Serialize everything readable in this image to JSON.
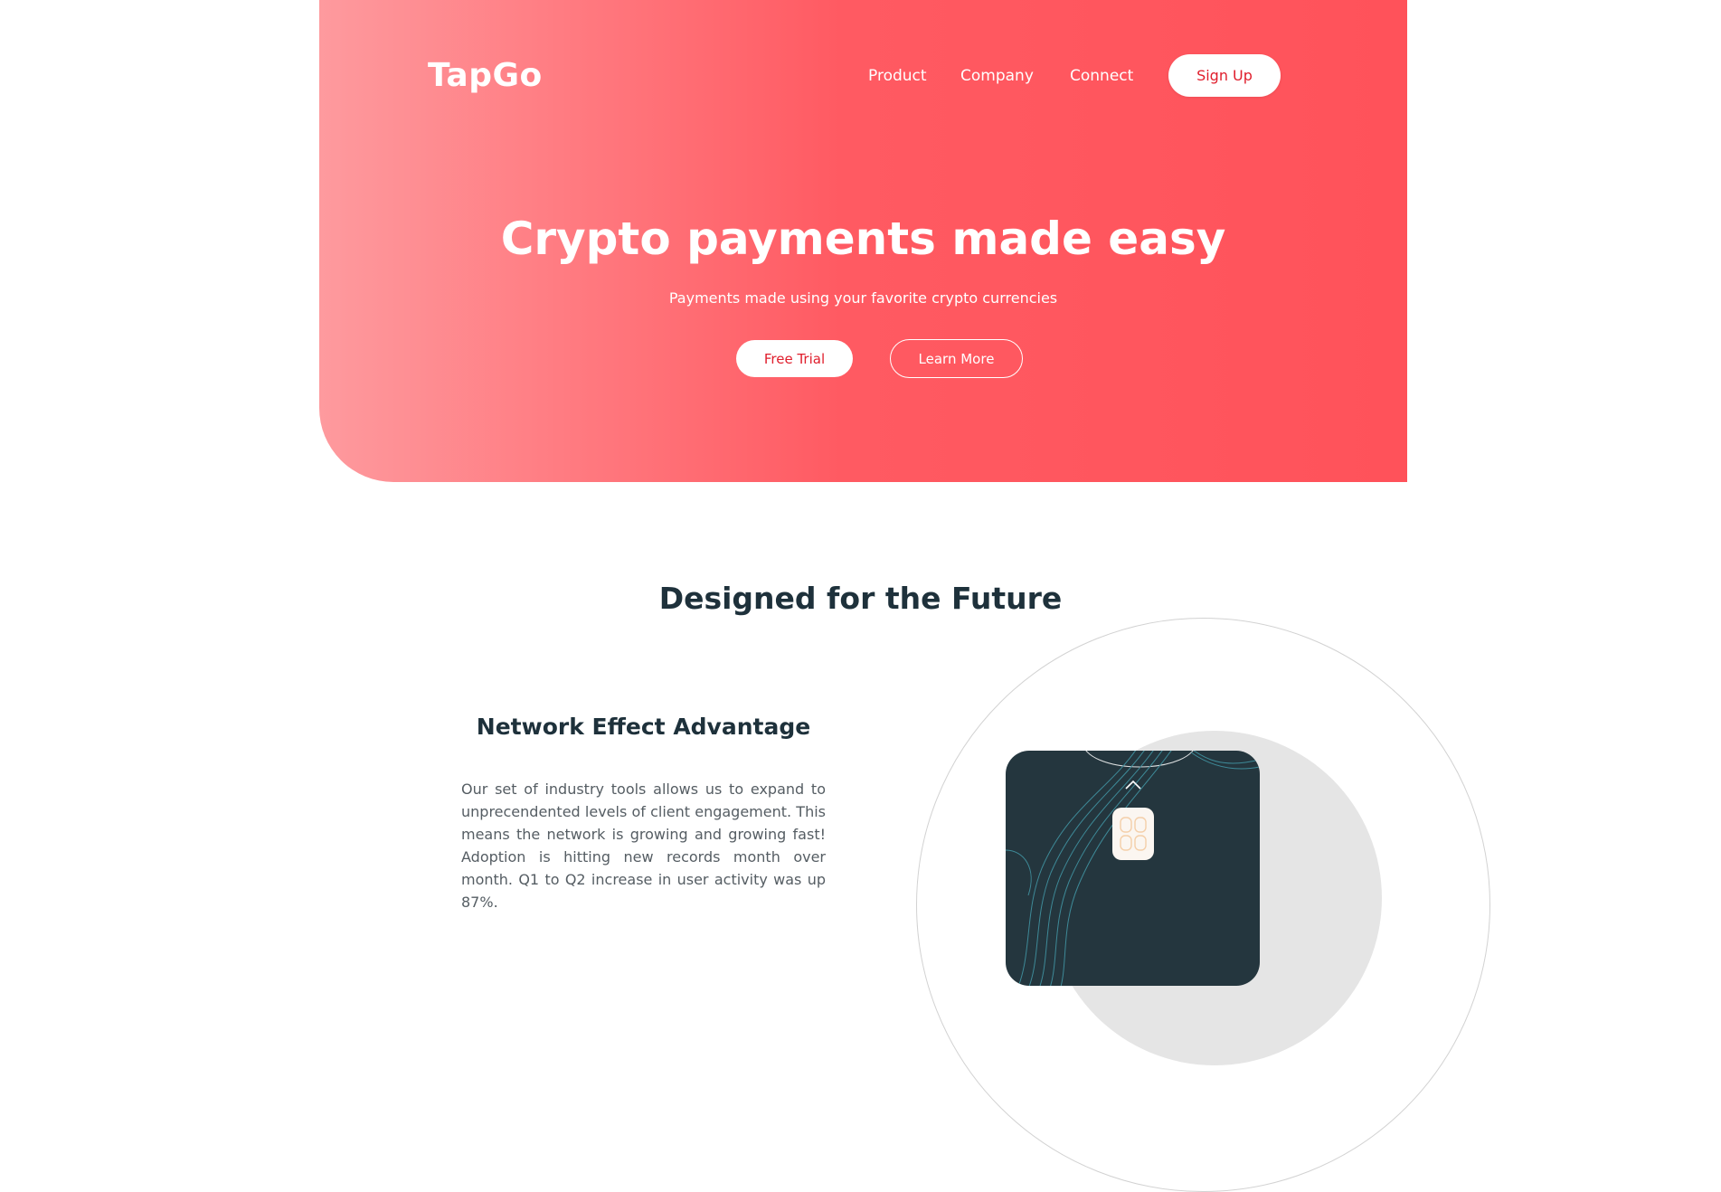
{
  "brand": {
    "logo_text": "TapGo",
    "accent_color": "#ff525a",
    "gradient_start": "#fe9a9e",
    "button_text_color": "#e01e2c",
    "dark_text_color": "#1e313b"
  },
  "nav": {
    "items": [
      {
        "label": "Product"
      },
      {
        "label": "Company"
      },
      {
        "label": "Connect"
      }
    ],
    "signup_label": "Sign Up"
  },
  "hero": {
    "title": "Crypto payments made easy",
    "subtitle": "Payments made using your favorite crypto currencies",
    "primary_button": "Free Trial",
    "secondary_button": "Learn More"
  },
  "features": {
    "section_title": "Designed for the Future",
    "heading": "Network Effect Advantage",
    "body": "Our set of industry tools allows us to expand to unprecendented levels of client engagement. This means the network is growing and growing fast! Adoption is hitting new records month over month. Q1 to Q2 increase in user activity was up 87%."
  },
  "illustration": {
    "card_color": "#24363e",
    "chip_color": "#fbf6f1",
    "icons": [
      "chevron-up-icon",
      "card-chip-icon"
    ]
  }
}
